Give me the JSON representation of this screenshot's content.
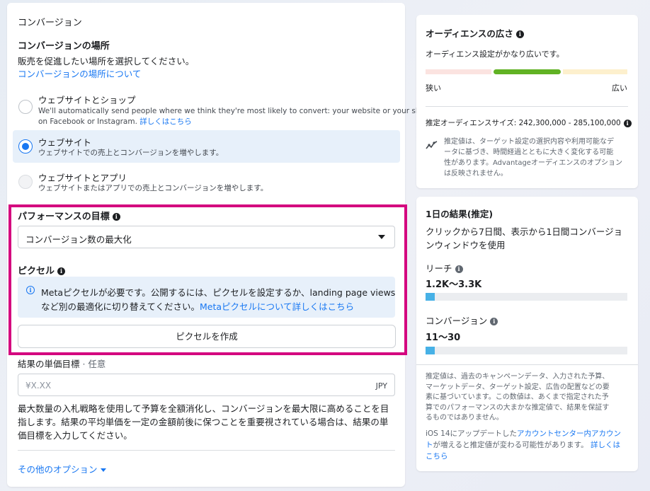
{
  "conversion": {
    "section_title": "コンバージョン",
    "location_heading": "コンバージョンの場所",
    "location_description": "販売を促進したい場所を選択してください。",
    "location_link": "コンバージョンの場所について",
    "options": [
      {
        "title": "ウェブサイトとショップ",
        "desc_line1": "We'll automatically send people where we think they're most likely to convert: your website or your shop",
        "desc_line2": "on Facebook or Instagram.",
        "desc_link": "詳しくはこちら",
        "state": "unselected"
      },
      {
        "title": "ウェブサイト",
        "desc_line1": "ウェブサイトでの売上とコンバージョンを増やします。",
        "state": "selected"
      },
      {
        "title": "ウェブサイトとアプリ",
        "desc_line1": "ウェブサイトまたはアプリでの売上とコンバージョンを増やします。",
        "state": "disabled"
      }
    ]
  },
  "performance": {
    "goal_label": "パフォーマンスの目標",
    "goal_value": "コンバージョン数の最大化",
    "pixel_label": "ピクセル",
    "notice_line1": "Metaピクセルが必要です。公開するには、ピクセルを設定するか、landing page views",
    "notice_line2": "など別の最適化に切り替えてください。",
    "notice_link": "Metaピクセルについて詳しくはこちら",
    "create_pixel_button": "ピクセルを作成"
  },
  "cost_goal": {
    "label": "結果の単価目標",
    "optional": " · 任意",
    "placeholder": "¥X.XX",
    "currency": "JPY",
    "help_line1": "最大数量の入札戦略を使用して予算を全額消化し、コンバージョンを最大限に高めることを目",
    "help_line2": "指します。結果の平均単価を一定の金額前後に保つことを重要視されている場合は、結果の単",
    "help_line3": "価目標を入力してください。",
    "more_options": "その他のオプション"
  },
  "audience": {
    "title": "オーディエンスの広さ",
    "status": "オーディエンス設定がかなり広いです。",
    "narrow_label": "狭い",
    "broad_label": "広い",
    "estimated_size": "推定オーディエンスサイズ: 242,300,000 - 285,100,000",
    "disclaimer_line1": "推定値は、ターゲット設定の選択内容や利用可能なデ",
    "disclaimer_line2": "ータに基づき、時間経過とともに大きく変化する可能",
    "disclaimer_line3": "性があります。Advantageオーディエンスのオプション",
    "disclaimer_line4": "は反映されません。",
    "gauge_colors": {
      "narrow": "#fbe3e0",
      "ideal": "#61b224",
      "broad": "#fdf0cd"
    }
  },
  "daily_results": {
    "title": "1日の結果(推定)",
    "window_line1": "クリックから7日間、表示から1日間コンバージョ",
    "window_line2": "ンウィンドウを使用",
    "reach_label": "リーチ",
    "reach_value": "1.2K〜3.3K",
    "conversions_label": "コンバージョン",
    "conversions_value": "11〜30",
    "note_line1": "推定値は、過去のキャンペーンデータ、入力された予算、",
    "note_line2": "マーケットデータ、ターゲット設定、広告の配置などの要",
    "note_line3": "素に基づいています。この数値は、あくまで指定された予",
    "note_line4": "算でのパフォーマンスの大まかな推定値で、結果を保証す",
    "note_line5": "るものではありません。",
    "ios_line1_a": "iOS 14にアップデートした",
    "ios_line1_link": "アカウントセンター内アカウン",
    "ios_line2_link": "ト",
    "ios_line2_b": "が増えると推定値が変わる可能性があります。",
    "ios_line2_link2": "詳しくは",
    "ios_line3_link": "こちら"
  },
  "colors": {
    "accent": "#1877f2",
    "highlight_border": "#d4067f",
    "selected_option_bg": "#e7f0fa",
    "result_bar": "#47b1e6"
  }
}
